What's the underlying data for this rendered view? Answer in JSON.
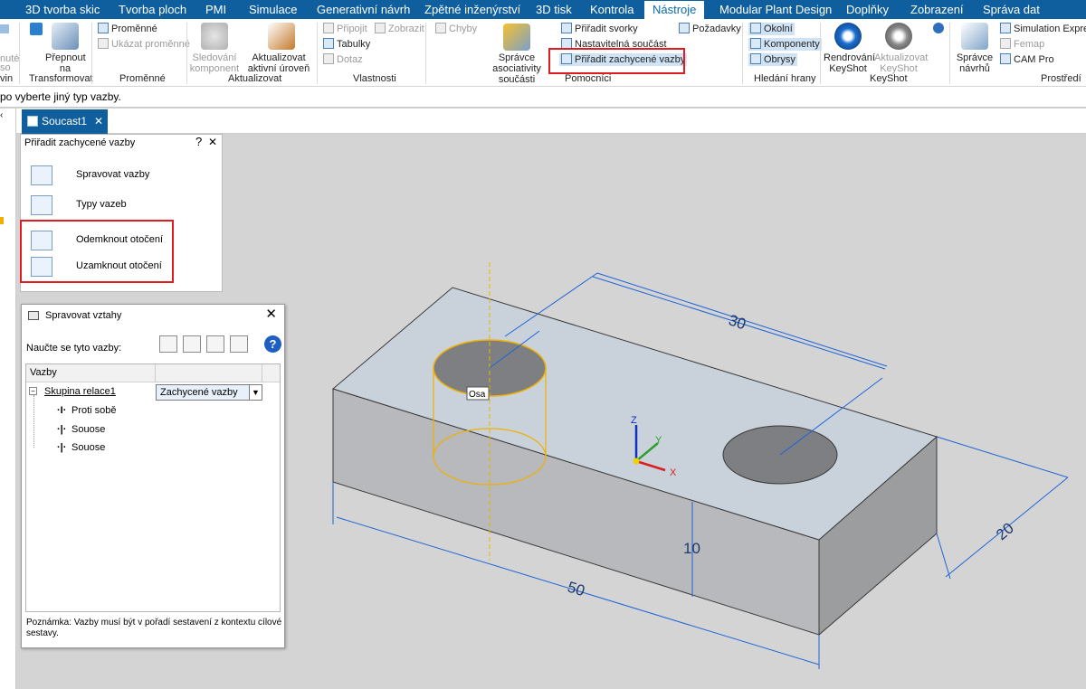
{
  "tabs": [
    "3D tvorba skic",
    "Tvorba ploch",
    "PMI",
    "Simulace",
    "Generativní návrh",
    "Zpětné inženýrství",
    "3D tisk",
    "Kontrola",
    "Nástroje",
    "Modular Plant Design",
    "Doplňky",
    "Zobrazení",
    "Správa dat"
  ],
  "active_tab": "Nástroje",
  "ribbon": {
    "cut_label1": "nuté",
    "cut_label2": "so",
    "cut_group": "vin",
    "prepnout_label": "Přepnout na",
    "transformovat_group": "Transformovat",
    "promenne": "Proměnné",
    "ukazat_promenne": "Ukázat proměnné",
    "promenne_group": "Proměnné",
    "sledovani": "Sledování komponent",
    "aktualizovat_uroven": "Aktualizovat aktivní úroveň",
    "aktualizovat_group": "Aktualizovat",
    "pripojit": "Připojit",
    "zobrazit": "Zobrazit",
    "chyby": "Chyby",
    "tabulky": "Tabulky",
    "dotaz": "Dotaz",
    "vlastnosti_group": "Vlastnosti",
    "spravce_asoc": "Správce asociativity součásti",
    "priradit_svorky": "Přiřadit svorky",
    "nastavitelna": "Nastavitelná součást",
    "priradit_zachycene": "Přiřadit zachycené vazby",
    "pozadavky": "Požadavky",
    "pomocnici_group": "Pomocníci",
    "okolni": "Okolní",
    "komponenty": "Komponenty",
    "obrysy": "Obrysy",
    "hledani_group": "Hledání hrany",
    "rendrovani": "Rendrování KeyShot",
    "aktualizovat_keyshot": "Aktualizovat KeyShot",
    "keyshot_group": "KeyShot",
    "spravce_navrhu": "Správce návrhů",
    "simulation_express": "Simulation Express",
    "femap": "Femap",
    "cam_pro": "CAM Pro",
    "prostredi_group": "Prostředí"
  },
  "prompt": "po vyberte jiný typ vazby.",
  "document_tab": "Soucast1",
  "popup": {
    "title": "Přiřadit zachycené vazby",
    "help": "?",
    "close": "✕",
    "items": [
      "Spravovat vazby",
      "Typy vazeb",
      "Odemknout otočení",
      "Uzamknout otočení"
    ]
  },
  "dialog": {
    "title": "Spravovat vztahy",
    "close": "✕",
    "learn_label": "Naučte se tyto vazby:",
    "help": "?",
    "column": "Vazby",
    "group_node": "Skupina relace1",
    "combo_value": "Zachycené vazby",
    "children": [
      "Proti sobě",
      "Souose",
      "Souose"
    ],
    "note": "Poznámka: Vazby musí být v pořadí sestavení z kontextu cílové sestavy."
  },
  "viewport": {
    "dim_length": "30",
    "dim_width": "50",
    "dim_height": "10",
    "dim_depth": "20",
    "axis_label": "Osa",
    "triad_x": "X",
    "triad_y": "Y",
    "triad_z": "Z"
  },
  "colors": {
    "tab_bar": "#0f5f9e",
    "highlight": "#e11b22",
    "dimension": "#1e64d8",
    "cylinder": "#f0b000",
    "part_top": "#c9d2db",
    "part_front": "#b7b9bc"
  }
}
